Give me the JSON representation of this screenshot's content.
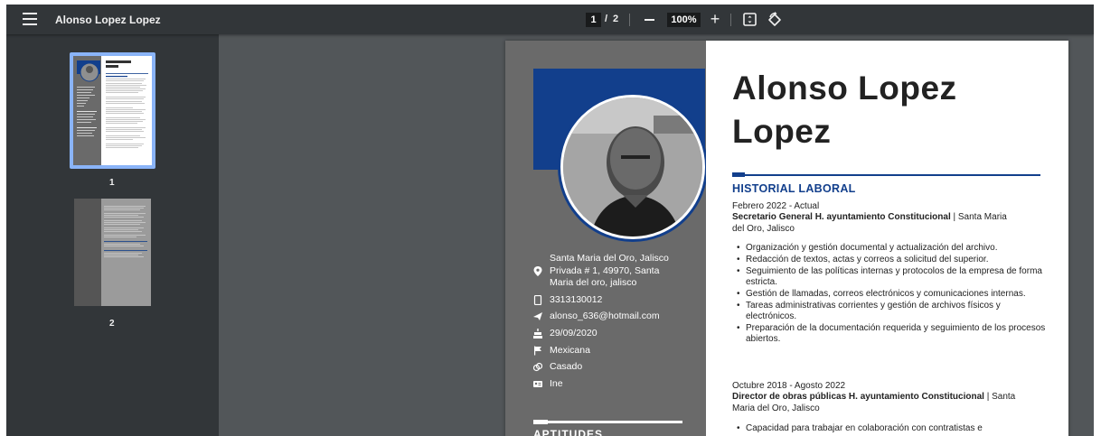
{
  "toolbar": {
    "title": "Alonso Lopez Lopez",
    "current_page": "1",
    "page_separator": "/",
    "total_pages": "2",
    "zoom": "100%"
  },
  "sidebar": {
    "thumbnails": [
      {
        "label": "1",
        "selected": true
      },
      {
        "label": "2",
        "selected": false
      }
    ]
  },
  "resume": {
    "name_line1": "Alonso Lopez",
    "name_line2": "Lopez",
    "contact": {
      "address_line1": "Santa Maria del Oro, Jalisco",
      "address_line2": "Privada # 1, 49970, Santa",
      "address_line3": "Maria del oro, jalisco",
      "phone": "3313130012",
      "email": "alonso_636@hotmail.com",
      "birthdate": "29/09/2020",
      "nationality": "Mexicana",
      "marital_status": "Casado",
      "id_doc": "Ine"
    },
    "skills_title": "APTITUDES",
    "history_title": "HISTORIAL LABORAL",
    "jobs": [
      {
        "date": "Febrero 2022 - Actual",
        "title": "Secretario General H. ayuntamiento Constitucional",
        "location_line1": " | Santa Maria",
        "location_line2": "del Oro, Jalisco",
        "bullets": [
          "Organización y gestión documental y actualización del archivo.",
          "Redacción de textos, actas y correos a solicitud del superior.",
          "Seguimiento de las políticas internas y protocolos de la empresa de forma estricta.",
          "Gestión de llamadas, correos electrónicos y comunicaciones internas.",
          "Tareas administrativas corrientes y gestión de archivos físicos y electrónicos.",
          "Preparación de la documentación requerida y seguimiento de los procesos abiertos."
        ]
      },
      {
        "date": "Octubre 2018 - Agosto 2022",
        "title": "Director de obras públicas H. ayuntamiento Constitucional",
        "location_line1": " | Santa",
        "location_line2": "Maria del Oro, Jalisco",
        "bullets": [
          "Capacidad para trabajar en colaboración con contratistas e"
        ]
      }
    ]
  },
  "colors": {
    "toolbar_bg": "#323639",
    "viewer_bg": "#525659",
    "accent_blue": "#123f8c",
    "resume_sidebar": "#6a6a6a",
    "thumb_selected": "#8ab4f8"
  }
}
